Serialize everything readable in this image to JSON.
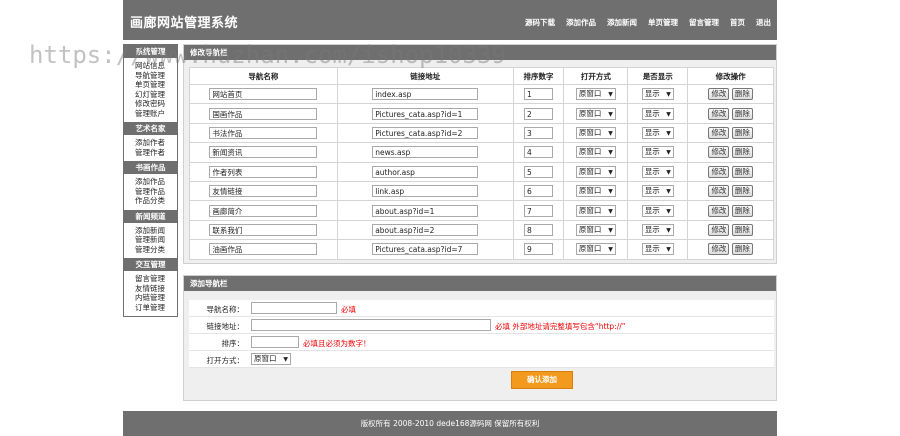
{
  "header": {
    "title": "画廊网站管理系统",
    "nav": [
      "源码下载",
      "添加作品",
      "添加新闻",
      "单页管理",
      "留言管理",
      "首页",
      "退出"
    ]
  },
  "sidebar": {
    "sections": [
      {
        "title": "系统管理",
        "items": [
          "网站信息",
          "导航管理",
          "单页管理",
          "幻灯管理",
          "修改密码",
          "管理账户"
        ]
      },
      {
        "title": "艺术名家",
        "items": [
          "添加作者",
          "管理作者"
        ]
      },
      {
        "title": "书画作品",
        "items": [
          "添加作品",
          "管理作品",
          "作品分类"
        ]
      },
      {
        "title": "新闻频道",
        "items": [
          "添加新闻",
          "管理新闻",
          "管理分类"
        ]
      },
      {
        "title": "交互管理",
        "items": [
          "留言管理",
          "友情链接",
          "内链管理",
          "订单管理"
        ]
      }
    ]
  },
  "nav_panel": {
    "title": "修改导航栏",
    "headers": [
      "导航名称",
      "链接地址",
      "排序数字",
      "打开方式",
      "是否显示",
      "修改操作"
    ],
    "rows": [
      {
        "name": "网站首页",
        "link": "index.asp",
        "order": "1",
        "open": "原窗口",
        "show": "显示"
      },
      {
        "name": "国画作品",
        "link": "Pictures_cata.asp?id=1",
        "order": "2",
        "open": "原窗口",
        "show": "显示"
      },
      {
        "name": "书法作品",
        "link": "Pictures_cata.asp?id=2",
        "order": "3",
        "open": "原窗口",
        "show": "显示"
      },
      {
        "name": "新闻资讯",
        "link": "news.asp",
        "order": "4",
        "open": "原窗口",
        "show": "显示"
      },
      {
        "name": "作者列表",
        "link": "author.asp",
        "order": "5",
        "open": "原窗口",
        "show": "显示"
      },
      {
        "name": "友情链接",
        "link": "link.asp",
        "order": "6",
        "open": "原窗口",
        "show": "显示"
      },
      {
        "name": "画廊简介",
        "link": "about.asp?id=1",
        "order": "7",
        "open": "原窗口",
        "show": "显示"
      },
      {
        "name": "联系我们",
        "link": "about.asp?id=2",
        "order": "8",
        "open": "原窗口",
        "show": "显示"
      },
      {
        "name": "油画作品",
        "link": "Pictures_cata.asp?id=7",
        "order": "9",
        "open": "原窗口",
        "show": "显示"
      }
    ],
    "edit_label": "修改",
    "delete_label": "删除"
  },
  "add_panel": {
    "title": "添加导航栏",
    "name_label": "导航名称：",
    "name_hint": "必填",
    "link_label": "链接地址：",
    "link_hint": "必填 外部地址请完整填写包含“http://”",
    "order_label": "排序：",
    "order_hint": "必填且必须为数字！",
    "open_label": "打开方式：",
    "open_value": "原窗口",
    "submit_label": "确认添加"
  },
  "footer": {
    "text": "版权所有 2008-2010 dede168源码网 保留所有权利"
  },
  "watermark": "https://www.huzhan.com/ishop10339"
}
